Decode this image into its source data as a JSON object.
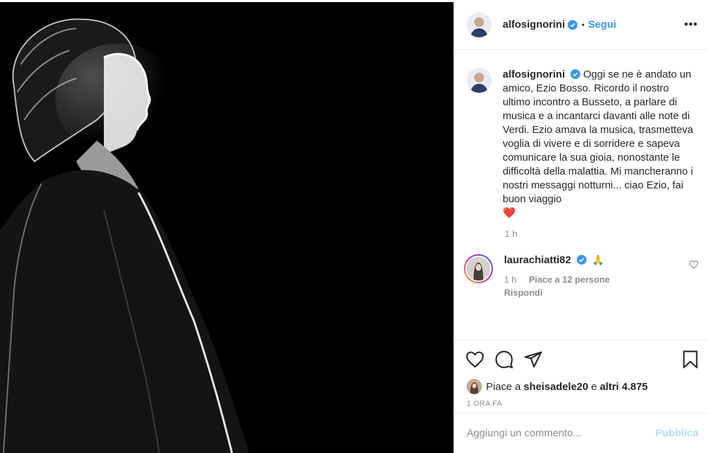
{
  "photo": {
    "icon": "concert-photo"
  },
  "header": {
    "username": "alfosignorini",
    "separator": "•",
    "follow_label": "Segui",
    "more_label": "•••"
  },
  "caption": {
    "username": "alfosignorini",
    "text": "Oggi se ne è andato un amico, Ezio Bosso. Ricordo il nostro ultimo incontro a Busseto, a parlare di musica e a incantarci davanti alle note di Verdi. Ezio amava la musica, trasmetteva voglia di vivere e di sorridere e sapeva comunicare la sua gioia, nonostante le difficoltà della malattia. Mi mancheranno i nostri messaggi notturni... ciao Ezio, fai buon viaggio",
    "emoji": "❤️",
    "time": "1 h"
  },
  "reply": {
    "username": "laurachiatti82",
    "emoji": "🙏",
    "time": "1 h",
    "likes": "Piace a 12 persone",
    "reply_label": "Rispondi"
  },
  "likes": {
    "prefix": "Piace a",
    "user": "sheisadele20",
    "connector": "e",
    "others": "altri 4.875"
  },
  "time_ago": "1 ORA FA",
  "add_comment": {
    "placeholder": "Aggiungi un commento...",
    "publish_label": "Pubblica"
  },
  "colors": {
    "accent": "#3897f0",
    "publish_disabled": "#b2dffc",
    "muted": "#8e8e8e",
    "heart": "#e0245e"
  }
}
